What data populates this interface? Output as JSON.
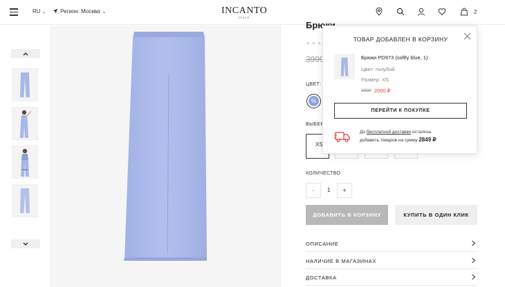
{
  "header": {
    "lang": "RU",
    "region": "Регион: Москва",
    "logo": "INCANTO",
    "logo_sub": "ITALY",
    "cart_count": "2",
    "icons": [
      "location-icon",
      "search-icon",
      "user-icon",
      "heart-icon",
      "bag-icon"
    ]
  },
  "product": {
    "title": "Брюки",
    "old_price": "3999",
    "color_label": "ЦВЕТ:",
    "size_label": "ВЫБЕР",
    "sizes": [
      "XS",
      "",
      "",
      ""
    ],
    "selected_size": "XS",
    "swatch_color": "#8ea4dd",
    "quantity_label": "КОЛИЧЕСТВО",
    "quantity": "1",
    "minus": "−",
    "plus": "+",
    "add_to_cart": "ДОБАВИТЬ В КОРЗИНУ",
    "one_click": "КУПИТЬ В ОДИН КЛИК",
    "accordion": [
      "ОПИСАНИЕ",
      "НАЛИЧИЕ В МАГАЗИНАХ",
      "ДОСТАВКА"
    ]
  },
  "popup": {
    "title": "ТОВАР ДОБАВЛЕН В КОРЗИНУ",
    "item_name": "Брюки PD973 (softly blue, 1)",
    "color": "Цвет: голубой",
    "size": "Размер: XS",
    "old_price": "3999",
    "new_price": "2000 ₽",
    "button": "ПЕРЕЙТИ К ПОКУПКЕ",
    "shipping_prefix": "До ",
    "shipping_link": "бесплатной доставки",
    "shipping_suffix": " осталось",
    "shipping_line2": "добавить товаров на сумму ",
    "shipping_amount": "2849 ₽"
  },
  "colors": {
    "accent_red": "#e23c3c",
    "pants": "#a9b7e8",
    "disabled_button": "#b8b8b8"
  }
}
